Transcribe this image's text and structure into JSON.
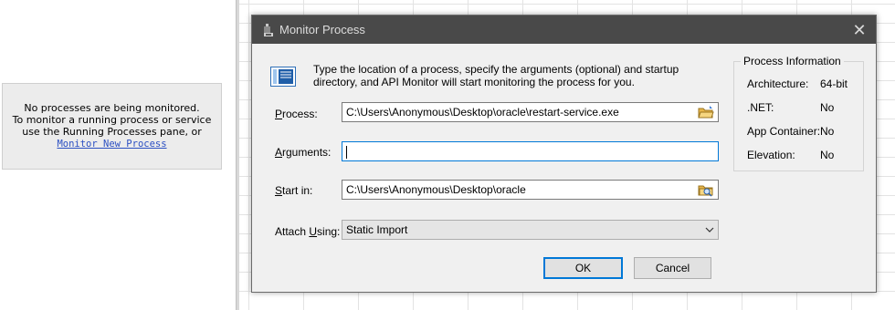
{
  "left_pane": {
    "empty_message_line1": "No processes are being monitored.",
    "empty_message_line2": "To monitor a running process or service",
    "empty_message_line3": "use the Running Processes pane, or",
    "monitor_link": "Monitor New Process"
  },
  "dialog": {
    "title": "Monitor Process",
    "close_glyph": "✕",
    "description": "Type the location of a process, specify the arguments (optional) and startup directory, and API Monitor will start monitoring the process for you.",
    "process": {
      "label_underlined": "P",
      "label_rest": "rocess:",
      "value": "C:\\Users\\Anonymous\\Desktop\\oracle\\restart-service.exe"
    },
    "arguments": {
      "label_underlined": "A",
      "label_rest": "rguments:",
      "value": ""
    },
    "start_in": {
      "label_underlined": "S",
      "label_rest": "tart in:",
      "value": "C:\\Users\\Anonymous\\Desktop\\oracle"
    },
    "attach_using": {
      "label_pre": "Attach ",
      "label_underlined": "U",
      "label_rest": "sing:",
      "selected": "Static Import"
    },
    "ok_label": "OK",
    "cancel_label": "Cancel",
    "process_information": {
      "title": "Process Information",
      "rows": [
        {
          "key": "Architecture:",
          "value": "64-bit"
        },
        {
          "key": ".NET:",
          "value": "No"
        },
        {
          "key": "App Container:",
          "value": "No"
        },
        {
          "key": "Elevation:",
          "value": "No"
        }
      ]
    }
  },
  "colors": {
    "titlebar": "#494949",
    "dialog_bg": "#f0f0f0",
    "focus_blue": "#0078d7",
    "link_blue": "#2b4fc2"
  },
  "icons": {
    "title_icon": "app-icon",
    "process_browse": "folder-open-icon",
    "startin_browse": "folder-search-icon",
    "description_icon": "window-icon",
    "select_chevron": "chevron-down-icon"
  }
}
